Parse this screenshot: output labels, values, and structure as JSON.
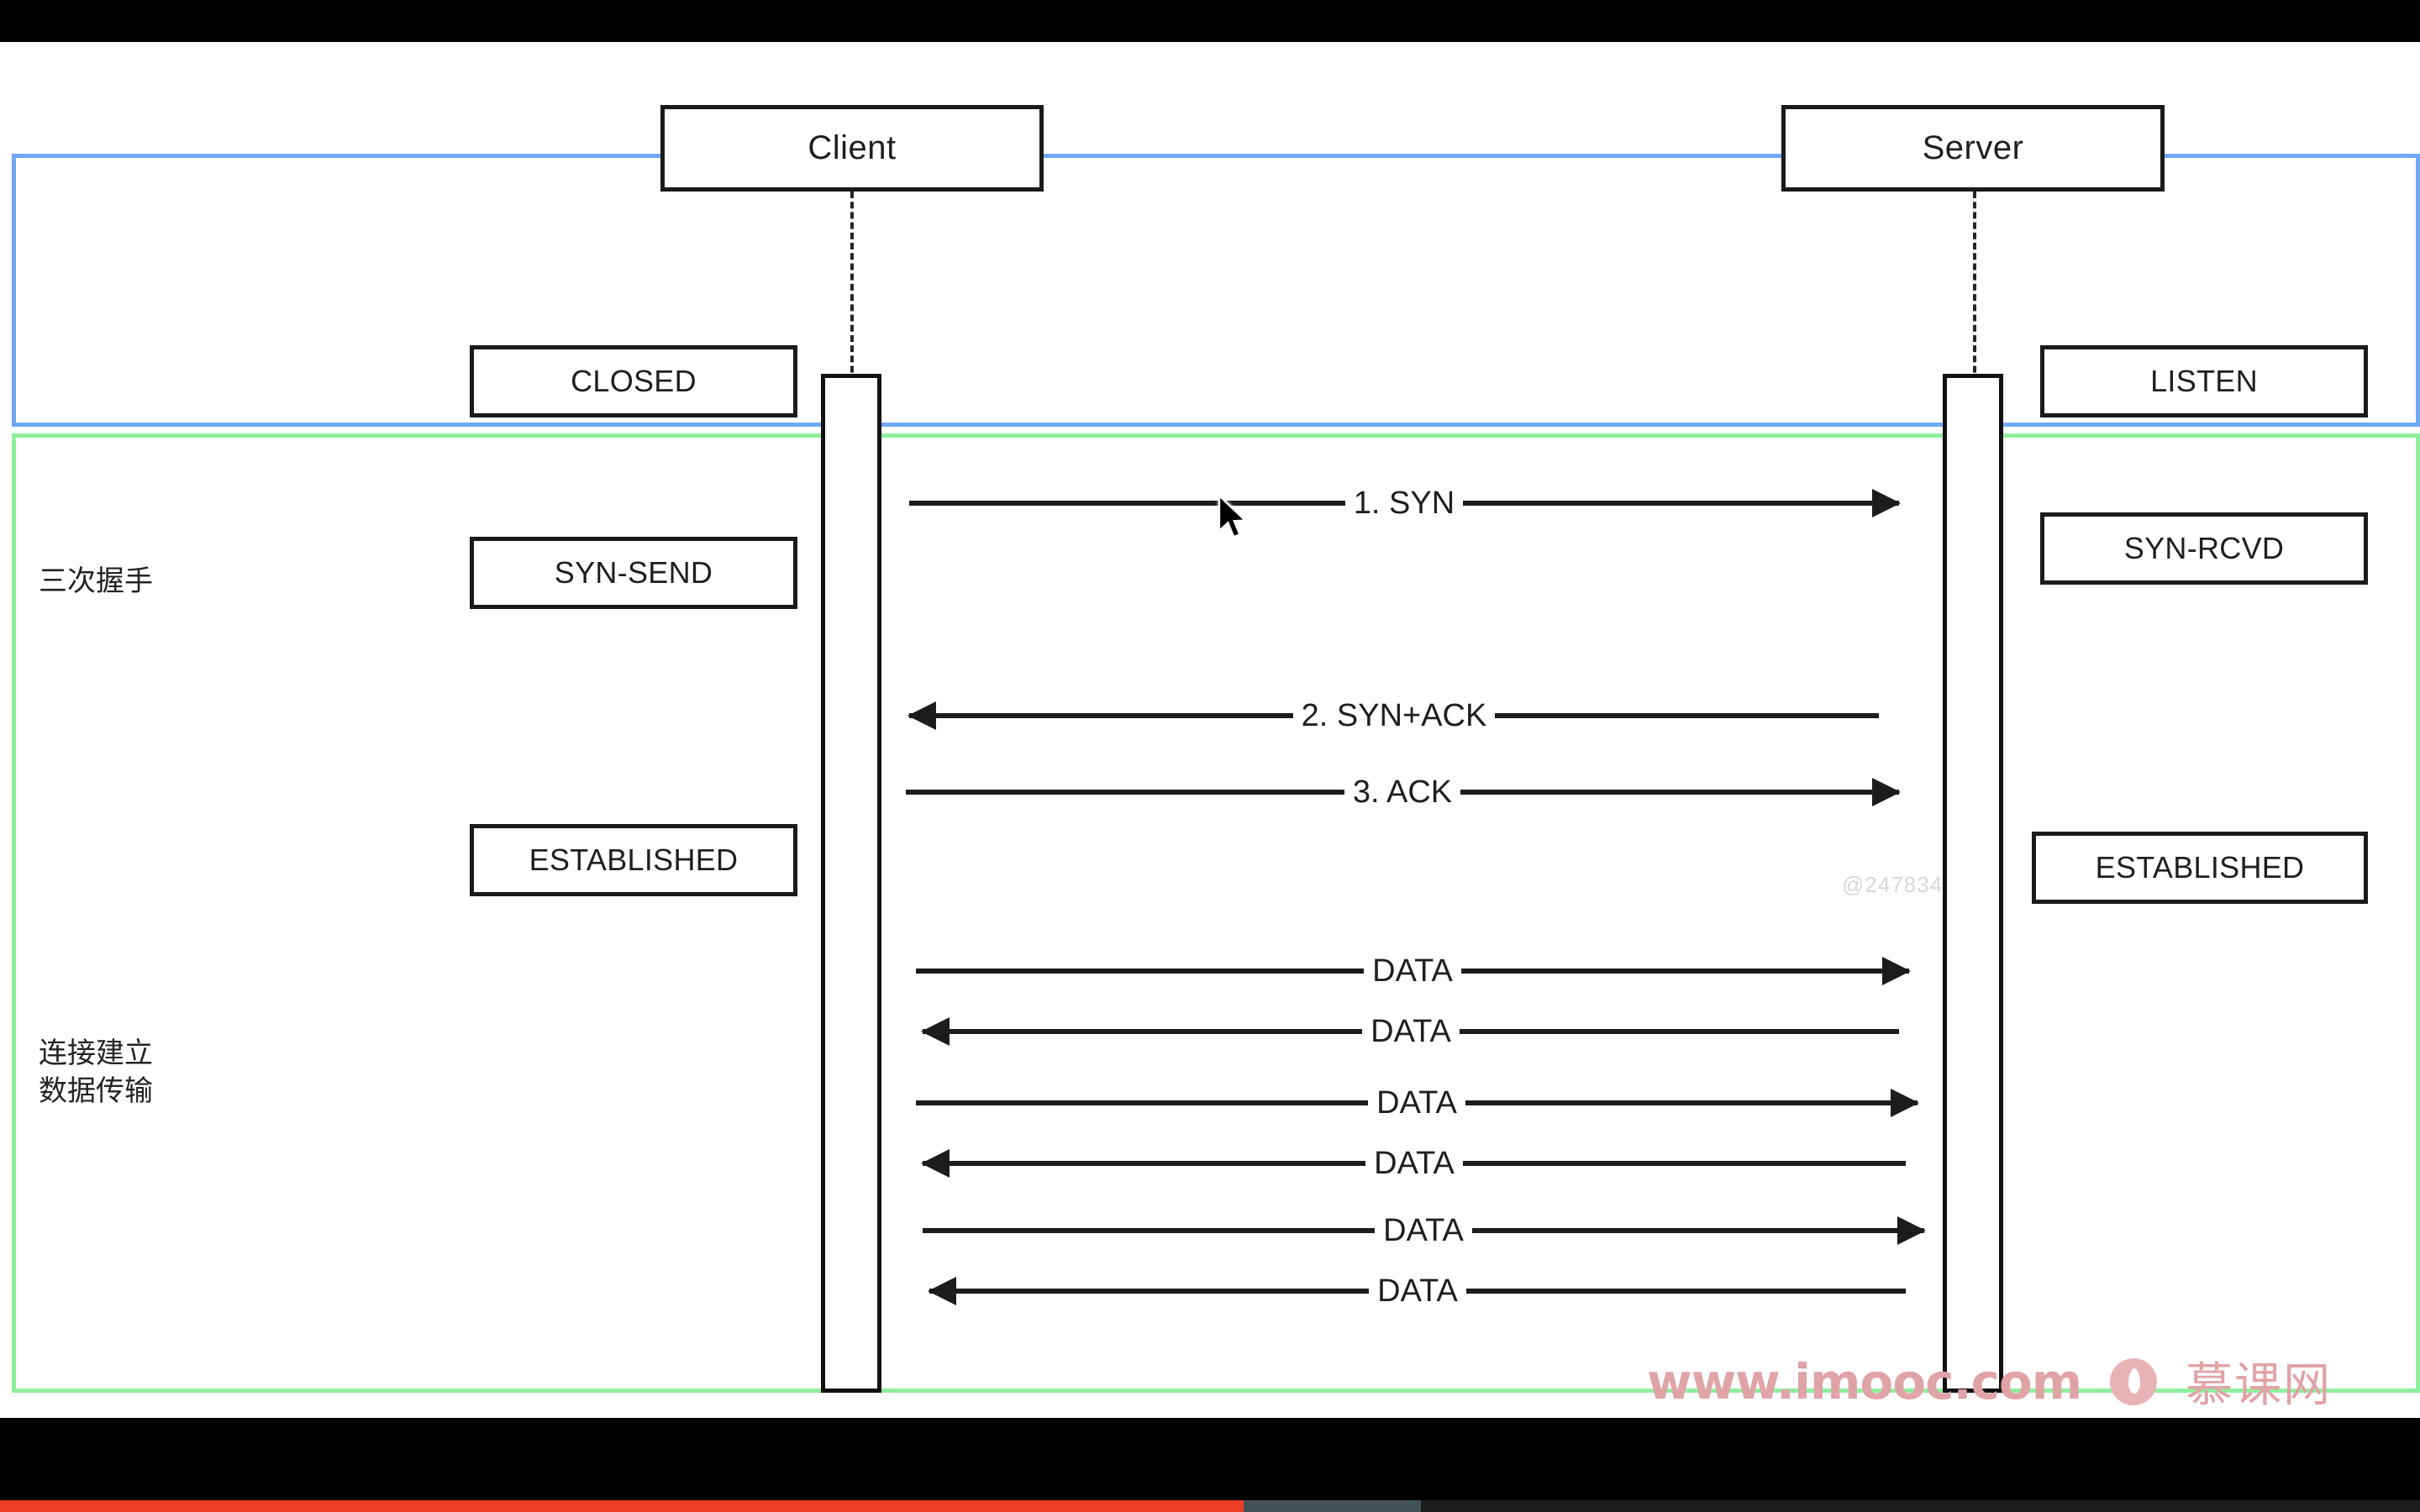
{
  "media": {
    "progress_played_percent": 51.4,
    "progress_buffered_percent": 58.7,
    "progress_played_color": "#ee3f26",
    "progress_buffered_color": "#44525a",
    "letterbox_color": "#000000"
  },
  "diagram": {
    "background": "#ffffff",
    "stroke_color": "#1a1a1a",
    "participants": [
      {
        "name": "client",
        "label": "Client"
      },
      {
        "name": "server",
        "label": "Server"
      }
    ],
    "groups": [
      {
        "name": "handshake",
        "label": "三次握手",
        "border_color": "#6fa8f5"
      },
      {
        "name": "transfer",
        "label": "连接建立\n数据传输",
        "border_color": "#8fee9c"
      }
    ],
    "states": {
      "client": [
        {
          "label": "CLOSED"
        },
        {
          "label": "SYN-SEND"
        },
        {
          "label": "ESTABLISHED"
        }
      ],
      "server": [
        {
          "label": "LISTEN"
        },
        {
          "label": "SYN-RCVD"
        },
        {
          "label": "ESTABLISHED"
        }
      ]
    },
    "messages": [
      {
        "label": "1. SYN",
        "direction": "to-right",
        "phase": "handshake"
      },
      {
        "label": "2. SYN+ACK",
        "direction": "to-left",
        "phase": "handshake"
      },
      {
        "label": "3. ACK",
        "direction": "to-right",
        "phase": "handshake"
      },
      {
        "label": "DATA",
        "direction": "to-right",
        "phase": "transfer"
      },
      {
        "label": "DATA",
        "direction": "to-left",
        "phase": "transfer"
      },
      {
        "label": "DATA",
        "direction": "to-right",
        "phase": "transfer"
      },
      {
        "label": "DATA",
        "direction": "to-left",
        "phase": "transfer"
      },
      {
        "label": "DATA",
        "direction": "to-right",
        "phase": "transfer"
      },
      {
        "label": "DATA",
        "direction": "to-left",
        "phase": "transfer"
      }
    ]
  },
  "watermarks": {
    "user_id": "@247834",
    "site_url": "www.imooc.com",
    "site_name": "慕课网",
    "brand_color": "#e0a3a6"
  }
}
